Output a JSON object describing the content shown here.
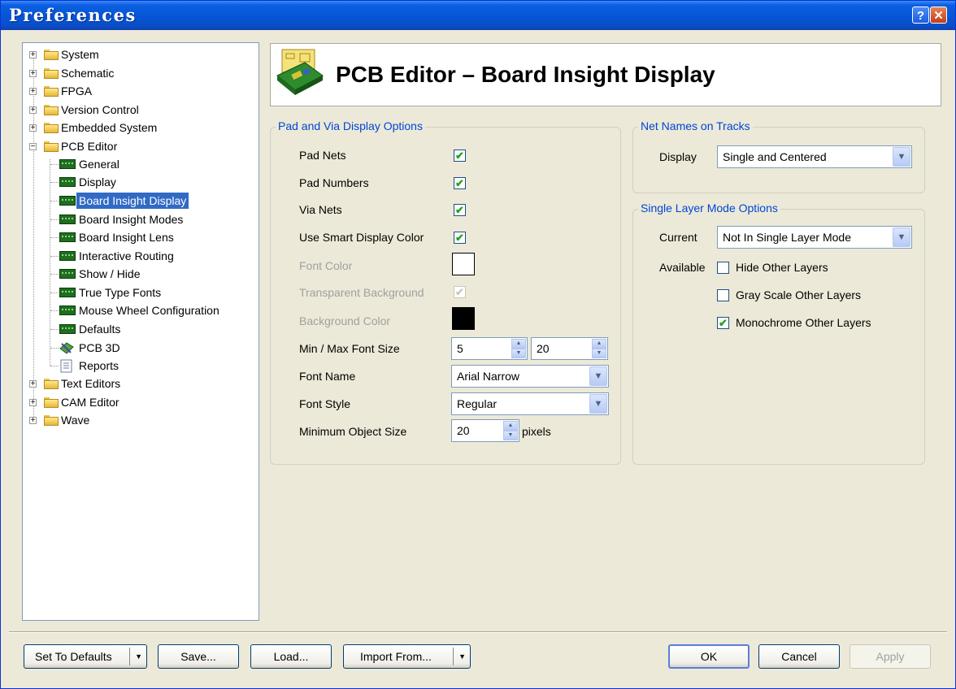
{
  "window": {
    "title": "Preferences",
    "help_glyph": "?",
    "close_glyph": "✕"
  },
  "tree": {
    "items": [
      {
        "label": "System"
      },
      {
        "label": "Schematic"
      },
      {
        "label": "FPGA"
      },
      {
        "label": "Version Control"
      },
      {
        "label": "Embedded System"
      },
      {
        "label": "PCB Editor"
      },
      {
        "label": "General"
      },
      {
        "label": "Display"
      },
      {
        "label": "Board Insight Display"
      },
      {
        "label": "Board Insight Modes"
      },
      {
        "label": "Board Insight Lens"
      },
      {
        "label": "Interactive Routing"
      },
      {
        "label": "Show / Hide"
      },
      {
        "label": "True Type Fonts"
      },
      {
        "label": "Mouse Wheel Configuration"
      },
      {
        "label": "Defaults"
      },
      {
        "label": "PCB 3D"
      },
      {
        "label": "Reports"
      },
      {
        "label": "Text Editors"
      },
      {
        "label": "CAM Editor"
      },
      {
        "label": "Wave"
      }
    ],
    "selected": "Board Insight Display"
  },
  "header": {
    "title": "PCB Editor – Board Insight Display"
  },
  "pad_via": {
    "group_title": "Pad and Via Display Options",
    "pad_nets": "Pad Nets",
    "pad_numbers": "Pad Numbers",
    "via_nets": "Via Nets",
    "smart_color": "Use Smart Display Color",
    "font_color": "Font Color",
    "transparent_bg": "Transparent Background",
    "bg_color": "Background Color",
    "min_max_font": "Min / Max Font Size",
    "min_font_value": "5",
    "max_font_value": "20",
    "font_name_label": "Font Name",
    "font_name_value": "Arial Narrow",
    "font_style_label": "Font Style",
    "font_style_value": "Regular",
    "min_obj_label": "Minimum Object Size",
    "min_obj_value": "20",
    "pixels": "pixels",
    "font_color_value": "#ffffff",
    "bg_color_value": "#000000"
  },
  "net_names": {
    "group_title": "Net Names on Tracks",
    "display_label": "Display",
    "display_value": "Single and Centered"
  },
  "single_layer": {
    "group_title": "Single Layer Mode Options",
    "current_label": "Current",
    "current_value": "Not In Single Layer Mode",
    "available_label": "Available",
    "hide_other": "Hide Other Layers",
    "gray_scale": "Gray Scale Other Layers",
    "monochrome": "Monochrome Other Layers"
  },
  "buttons": {
    "set_defaults": "Set To Defaults",
    "save": "Save...",
    "load": "Load...",
    "import_from": "Import From...",
    "ok": "OK",
    "cancel": "Cancel",
    "apply": "Apply"
  },
  "checkmark": "✔",
  "colors": {
    "title_bar": "#0654d6",
    "selection": "#316ac5",
    "group_title": "#0046d5",
    "dialog_bg": "#ece9d8"
  }
}
